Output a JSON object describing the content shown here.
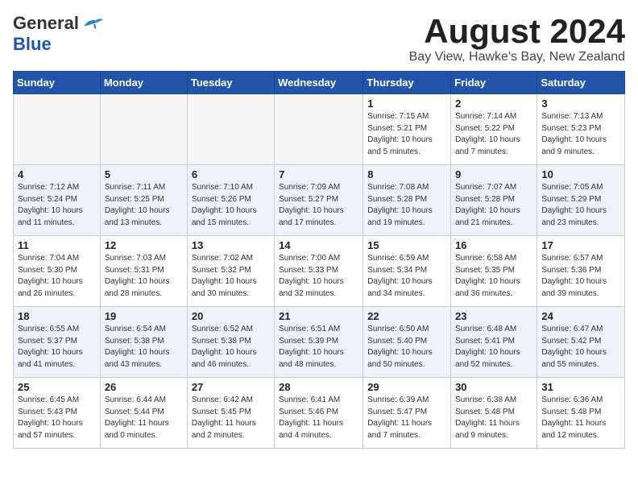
{
  "header": {
    "logo_general": "General",
    "logo_blue": "Blue",
    "month_year": "August 2024",
    "location": "Bay View, Hawke's Bay, New Zealand"
  },
  "weekdays": [
    "Sunday",
    "Monday",
    "Tuesday",
    "Wednesday",
    "Thursday",
    "Friday",
    "Saturday"
  ],
  "weeks": [
    [
      {
        "day": "",
        "info": ""
      },
      {
        "day": "",
        "info": ""
      },
      {
        "day": "",
        "info": ""
      },
      {
        "day": "",
        "info": ""
      },
      {
        "day": "1",
        "info": "Sunrise: 7:15 AM\nSunset: 5:21 PM\nDaylight: 10 hours\nand 5 minutes."
      },
      {
        "day": "2",
        "info": "Sunrise: 7:14 AM\nSunset: 5:22 PM\nDaylight: 10 hours\nand 7 minutes."
      },
      {
        "day": "3",
        "info": "Sunrise: 7:13 AM\nSunset: 5:23 PM\nDaylight: 10 hours\nand 9 minutes."
      }
    ],
    [
      {
        "day": "4",
        "info": "Sunrise: 7:12 AM\nSunset: 5:24 PM\nDaylight: 10 hours\nand 11 minutes."
      },
      {
        "day": "5",
        "info": "Sunrise: 7:11 AM\nSunset: 5:25 PM\nDaylight: 10 hours\nand 13 minutes."
      },
      {
        "day": "6",
        "info": "Sunrise: 7:10 AM\nSunset: 5:26 PM\nDaylight: 10 hours\nand 15 minutes."
      },
      {
        "day": "7",
        "info": "Sunrise: 7:09 AM\nSunset: 5:27 PM\nDaylight: 10 hours\nand 17 minutes."
      },
      {
        "day": "8",
        "info": "Sunrise: 7:08 AM\nSunset: 5:28 PM\nDaylight: 10 hours\nand 19 minutes."
      },
      {
        "day": "9",
        "info": "Sunrise: 7:07 AM\nSunset: 5:28 PM\nDaylight: 10 hours\nand 21 minutes."
      },
      {
        "day": "10",
        "info": "Sunrise: 7:05 AM\nSunset: 5:29 PM\nDaylight: 10 hours\nand 23 minutes."
      }
    ],
    [
      {
        "day": "11",
        "info": "Sunrise: 7:04 AM\nSunset: 5:30 PM\nDaylight: 10 hours\nand 26 minutes."
      },
      {
        "day": "12",
        "info": "Sunrise: 7:03 AM\nSunset: 5:31 PM\nDaylight: 10 hours\nand 28 minutes."
      },
      {
        "day": "13",
        "info": "Sunrise: 7:02 AM\nSunset: 5:32 PM\nDaylight: 10 hours\nand 30 minutes."
      },
      {
        "day": "14",
        "info": "Sunrise: 7:00 AM\nSunset: 5:33 PM\nDaylight: 10 hours\nand 32 minutes."
      },
      {
        "day": "15",
        "info": "Sunrise: 6:59 AM\nSunset: 5:34 PM\nDaylight: 10 hours\nand 34 minutes."
      },
      {
        "day": "16",
        "info": "Sunrise: 6:58 AM\nSunset: 5:35 PM\nDaylight: 10 hours\nand 36 minutes."
      },
      {
        "day": "17",
        "info": "Sunrise: 6:57 AM\nSunset: 5:36 PM\nDaylight: 10 hours\nand 39 minutes."
      }
    ],
    [
      {
        "day": "18",
        "info": "Sunrise: 6:55 AM\nSunset: 5:37 PM\nDaylight: 10 hours\nand 41 minutes."
      },
      {
        "day": "19",
        "info": "Sunrise: 6:54 AM\nSunset: 5:38 PM\nDaylight: 10 hours\nand 43 minutes."
      },
      {
        "day": "20",
        "info": "Sunrise: 6:52 AM\nSunset: 5:38 PM\nDaylight: 10 hours\nand 46 minutes."
      },
      {
        "day": "21",
        "info": "Sunrise: 6:51 AM\nSunset: 5:39 PM\nDaylight: 10 hours\nand 48 minutes."
      },
      {
        "day": "22",
        "info": "Sunrise: 6:50 AM\nSunset: 5:40 PM\nDaylight: 10 hours\nand 50 minutes."
      },
      {
        "day": "23",
        "info": "Sunrise: 6:48 AM\nSunset: 5:41 PM\nDaylight: 10 hours\nand 52 minutes."
      },
      {
        "day": "24",
        "info": "Sunrise: 6:47 AM\nSunset: 5:42 PM\nDaylight: 10 hours\nand 55 minutes."
      }
    ],
    [
      {
        "day": "25",
        "info": "Sunrise: 6:45 AM\nSunset: 5:43 PM\nDaylight: 10 hours\nand 57 minutes."
      },
      {
        "day": "26",
        "info": "Sunrise: 6:44 AM\nSunset: 5:44 PM\nDaylight: 11 hours\nand 0 minutes."
      },
      {
        "day": "27",
        "info": "Sunrise: 6:42 AM\nSunset: 5:45 PM\nDaylight: 11 hours\nand 2 minutes."
      },
      {
        "day": "28",
        "info": "Sunrise: 6:41 AM\nSunset: 5:46 PM\nDaylight: 11 hours\nand 4 minutes."
      },
      {
        "day": "29",
        "info": "Sunrise: 6:39 AM\nSunset: 5:47 PM\nDaylight: 11 hours\nand 7 minutes."
      },
      {
        "day": "30",
        "info": "Sunrise: 6:38 AM\nSunset: 5:48 PM\nDaylight: 11 hours\nand 9 minutes."
      },
      {
        "day": "31",
        "info": "Sunrise: 6:36 AM\nSunset: 5:48 PM\nDaylight: 11 hours\nand 12 minutes."
      }
    ]
  ]
}
